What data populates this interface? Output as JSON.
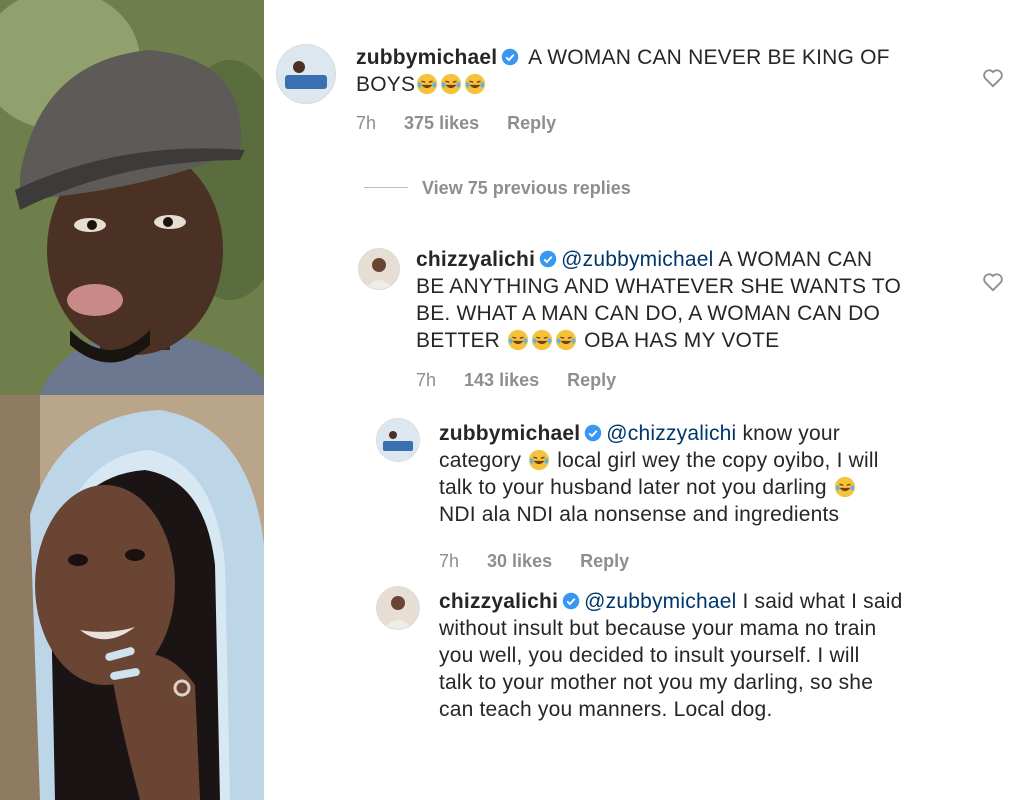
{
  "photos": {
    "top_alt": "man in grey flat cap sticking out tongue",
    "bottom_alt": "woman in blue hooded scarf smiling"
  },
  "comments": [
    {
      "username": "zubbymichael",
      "text_a": "A WOMAN CAN NEVER BE KING OF",
      "text_b": "BOYS",
      "time": "7h",
      "likes": "375 likes",
      "reply": "Reply"
    },
    {
      "username": "chizzyalichi",
      "mention": "@zubbymichael",
      "text_a": " A WOMAN CAN",
      "text_b": "BE ANYTHING AND WHATEVER SHE WANTS TO",
      "text_c": "BE. WHAT A MAN CAN DO, A WOMAN CAN DO",
      "text_d": "BETTER",
      "text_e": " OBA HAS MY VOTE",
      "time": "7h",
      "likes": "143 likes",
      "reply": "Reply"
    },
    {
      "username": "zubbymichael",
      "mention": "@chizzyalichi",
      "text_a": " know your",
      "text_b": "category",
      "text_c": " local girl wey the copy oyibo, I will",
      "text_d": "talk to your husband later not you darling",
      "text_e": "NDI ala NDI ala nonsense and  ingredients",
      "time": "7h",
      "likes": "30 likes",
      "reply": "Reply"
    },
    {
      "username": "chizzyalichi",
      "mention": "@zubbymichael",
      "text_a": " I said what I said",
      "text_b": "without insult but because your mama no train",
      "text_c": "you well, you decided to insult yourself. I will",
      "text_d": "talk to your mother not you my darling, so she",
      "text_e": "can teach you manners. Local dog."
    }
  ],
  "view_replies": "View 75 previous replies",
  "colors": {
    "verified": "#3897f0",
    "muted": "#8e8e8e",
    "mention": "#00376b"
  },
  "icons": [
    "verified-badge-icon",
    "laughing-emoji-icon",
    "heart-icon"
  ]
}
